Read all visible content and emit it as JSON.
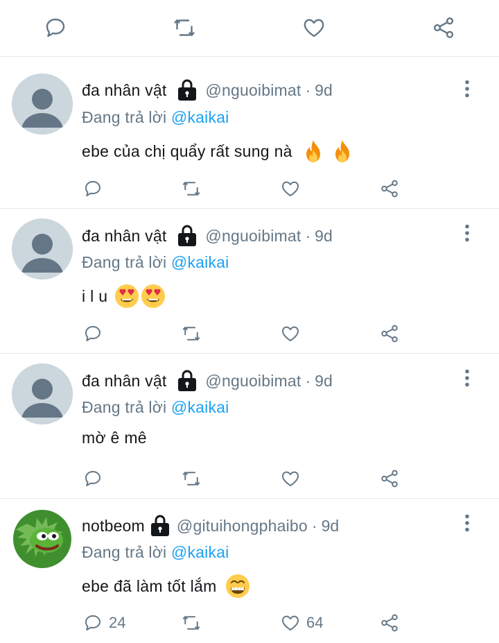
{
  "icons": {
    "reply": "reply-icon",
    "retweet": "retweet-icon",
    "like": "heart-icon",
    "share": "share-icon",
    "lock": "lock-icon",
    "more": "more-vertical-icon"
  },
  "colors": {
    "text": "#14171a",
    "muted": "#657786",
    "link": "#1da1f2",
    "divider": "#e1e8ed",
    "avatar_default": "#ccd6dd"
  },
  "tweets": [
    {
      "name": "đa nhân vật",
      "handle": "@nguoibimat",
      "separator": "·",
      "time": "9d",
      "reply_prefix": "Đang trả lời",
      "reply_to": "@kaikai",
      "text": "ebe của chị quẩy rất sung nà",
      "emojis": [
        "fire",
        "fire"
      ],
      "reply_count": "",
      "like_count": ""
    },
    {
      "name": "đa nhân vật",
      "handle": "@nguoibimat",
      "separator": "·",
      "time": "9d",
      "reply_prefix": "Đang trả lời",
      "reply_to": "@kaikai",
      "text": "i l u",
      "emojis": [
        "heart-eyes",
        "heart-eyes"
      ],
      "reply_count": "",
      "like_count": ""
    },
    {
      "name": "đa nhân vật",
      "handle": "@nguoibimat",
      "separator": "·",
      "time": "9d",
      "reply_prefix": "Đang trả lời",
      "reply_to": "@kaikai",
      "text": "mờ ê mê",
      "emojis": [],
      "reply_count": "",
      "like_count": ""
    },
    {
      "name": "notbeom",
      "handle": "@gituihongphaibo",
      "separator": "·",
      "time": "9d",
      "reply_prefix": "Đang trả lời",
      "reply_to": "@kaikai",
      "text": "ebe đã làm tốt lắm",
      "emojis": [
        "grin"
      ],
      "reply_count": "24",
      "like_count": "64"
    }
  ]
}
